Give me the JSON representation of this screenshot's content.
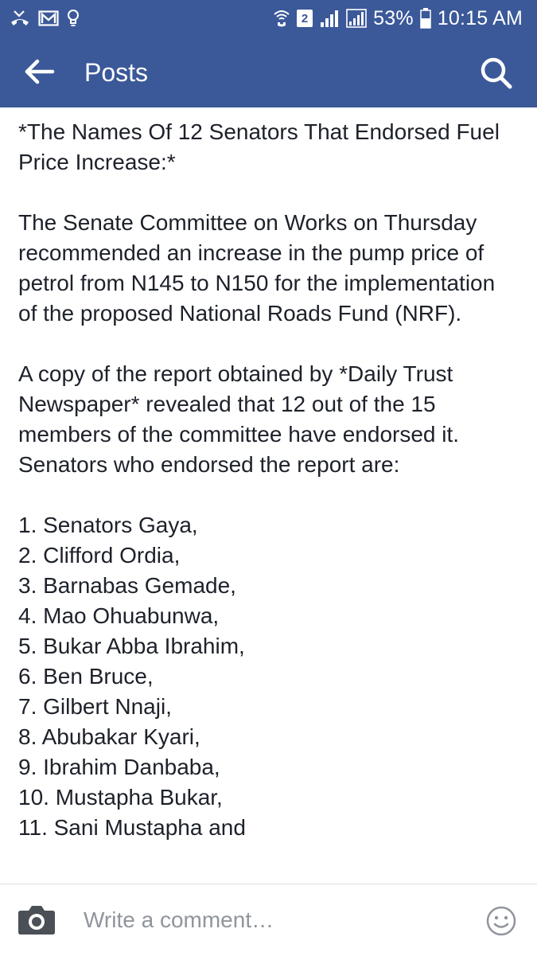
{
  "status_bar": {
    "battery_percent": "53%",
    "time": "10:15 AM",
    "sim_number": "2",
    "icons": [
      "missed-call-icon",
      "gmail-icon",
      "lightbulb-icon",
      "wifi-calling-icon",
      "sim-icon",
      "signal-icon",
      "signal-icon",
      "battery-icon"
    ]
  },
  "header": {
    "title": "Posts",
    "back_icon": "back-arrow-icon",
    "search_icon": "search-icon",
    "color": "#3b5998"
  },
  "post": {
    "title": "*The Names Of 12 Senators That Endorsed Fuel Price Increase:*",
    "paragraphs": [
      "The Senate Committee on Works on Thursday recommended an increase in the pump price of petrol from N145 to N150 for the implementation of the proposed National Roads Fund (NRF).",
      "A copy of the report obtained by *Daily Trust Newspaper* revealed that 12 out of the 15 members of the committee have endorsed it. Senators who endorsed the report are:"
    ],
    "senators": [
      "1. Senators Gaya,",
      "2. Clifford Ordia,",
      "3. Barnabas Gemade,",
      "4. Mao Ohuabunwa,",
      "5. Bukar Abba Ibrahim,",
      "6. Ben Bruce,",
      "7. Gilbert Nnaji,",
      "8. Abubakar Kyari,",
      "9. Ibrahim Danbaba,",
      "10. Mustapha Bukar,",
      "11. Sani Mustapha and"
    ]
  },
  "comment_bar": {
    "placeholder": "Write a comment…",
    "camera_icon": "camera-icon",
    "emoji_icon": "smiley-icon"
  }
}
